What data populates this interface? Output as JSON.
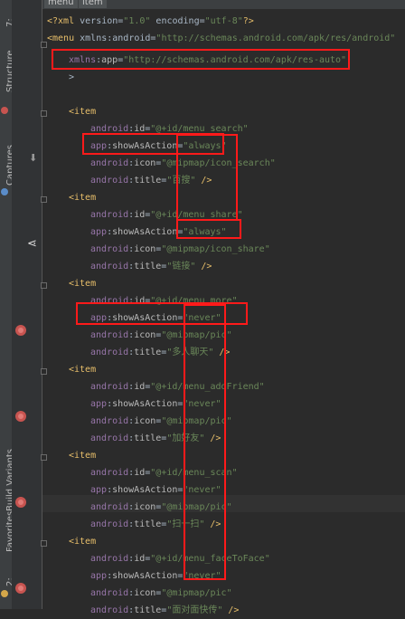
{
  "tabs": [
    "menu",
    "item"
  ],
  "side_tool_windows": [
    "Structure",
    "Captures",
    "Build Variants",
    "Favorites"
  ],
  "side_numbers": [
    "7:",
    "2:"
  ],
  "code": {
    "xml_decl": "<?xml version=\"1.0\" encoding=\"utf-8\"?>",
    "menu_open": "<menu xmlns:android=\"http://schemas.android.com/apk/res/android\"",
    "menu_xmlns_app": "xmlns:app=\"http://schemas.android.com/apk/res-auto\"",
    "menu_close": ">",
    "items": [
      {
        "open": "<item",
        "id": "android:id=\"@+id/menu_search\"",
        "show": "app:showAsAction=\"always\"",
        "icon": "android:icon=\"@mipmap/icon_search\"",
        "title": "android:title=\"百搜\" />"
      },
      {
        "open": "<item",
        "id": "android:id=\"@+id/menu_share\"",
        "show": "app:showAsAction=\"always\"",
        "icon": "android:icon=\"@mipmap/icon_share\"",
        "title": "android:title=\"链接\" />"
      },
      {
        "open": "<item",
        "id": "android:id=\"@+id/menu_more\"",
        "show": "app:showAsAction=\"never\"",
        "icon": "android:icon=\"@mipmap/pic\"",
        "title": "android:title=\"多人聊天\" />"
      },
      {
        "open": "<item",
        "id": "android:id=\"@+id/menu_addFriend\"",
        "show": "app:showAsAction=\"never\"",
        "icon": "android:icon=\"@mipmap/pic\"",
        "title": "android:title=\"加好友\" />"
      },
      {
        "open": "<item",
        "id": "android:id=\"@+id/menu_scan\"",
        "show": "app:showAsAction=\"never\"",
        "icon": "android:icon=\"@mipmap/pic\"",
        "title": "android:title=\"扫一扫\" />"
      },
      {
        "open": "<item",
        "id": "android:id=\"@+id/menu_faceToFace\"",
        "show": "app:showAsAction=\"never\"",
        "icon": "android:icon=\"@mipmap/pic\"",
        "title": "android:title=\"面对面快传\" />"
      }
    ]
  }
}
